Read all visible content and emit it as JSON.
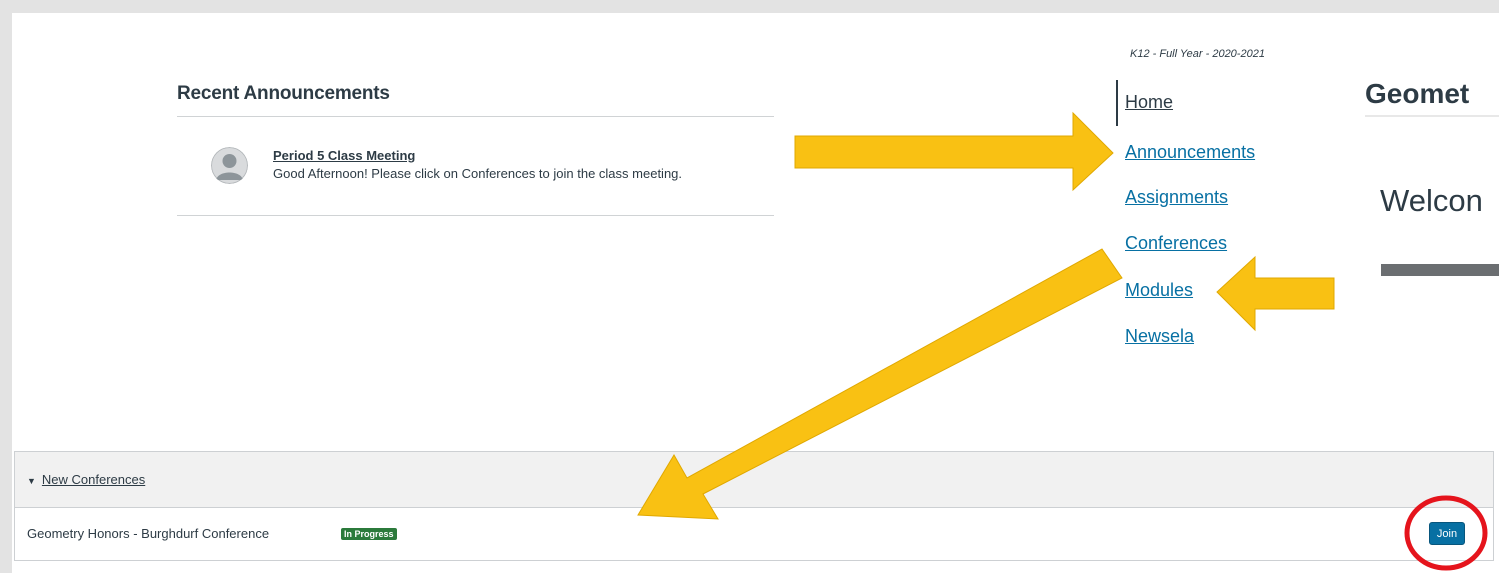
{
  "announcements": {
    "heading": "Recent Announcements",
    "items": [
      {
        "title": "Period 5 Class Meeting",
        "message": "Good Afternoon! Please click on Conferences to join the class meeting."
      }
    ]
  },
  "course": {
    "term": "K12 - Full Year - 2020-2021",
    "title": "Geomet",
    "welcome": "Welcon"
  },
  "nav": {
    "items": [
      {
        "label": "Home",
        "active": true
      },
      {
        "label": "Announcements"
      },
      {
        "label": "Assignments"
      },
      {
        "label": "Conferences"
      },
      {
        "label": "Modules"
      },
      {
        "label": "Newsela"
      }
    ]
  },
  "conferences": {
    "section_label": "New Conferences",
    "rows": [
      {
        "name": "Geometry Honors - Burghdurf Conference",
        "status": "In Progress",
        "action": "Join"
      }
    ]
  },
  "colors": {
    "link": "#0770a3",
    "text": "#2d3b45",
    "arrow": "#f9c113",
    "highlight_circle": "#e5141c",
    "status_badge": "#2b7a3b"
  }
}
